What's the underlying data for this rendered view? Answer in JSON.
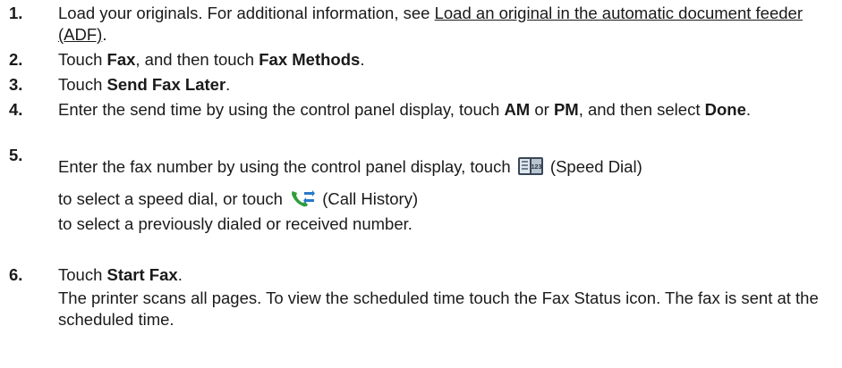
{
  "steps": [
    {
      "num": "1.",
      "pre": "Load your originals. For additional information, see ",
      "link": "Load an original in the automatic document feeder (ADF)",
      "post": "."
    },
    {
      "num": "2.",
      "pre": "Touch ",
      "b1": "Fax",
      "mid": ", and then touch ",
      "b2": "Fax Methods",
      "post": "."
    },
    {
      "num": "3.",
      "pre": "Touch ",
      "b1": "Send Fax Later",
      "post": "."
    },
    {
      "num": "4.",
      "pre": "Enter the send time by using the control panel display, touch ",
      "b1": "AM",
      "mid": " or ",
      "b2": "PM",
      "mid2": ", and then select ",
      "b3": "Done",
      "post": "."
    },
    {
      "num": "5.",
      "pre": "Enter the fax number by using the control panel display, touch ",
      "icon1_label": "(Speed Dial)",
      "mid": "to select a speed dial, or touch ",
      "icon2_label": "(Call History)",
      "post": "to select a previously dialed or received number.",
      "icon1": "speed-dial-icon",
      "icon2": "call-history-icon"
    },
    {
      "num": "6.",
      "pre": "Touch ",
      "b1": "Start Fax",
      "post": ".",
      "note": "The printer scans all pages. To view the scheduled time touch the Fax Status icon. The fax is sent at the scheduled time."
    }
  ]
}
